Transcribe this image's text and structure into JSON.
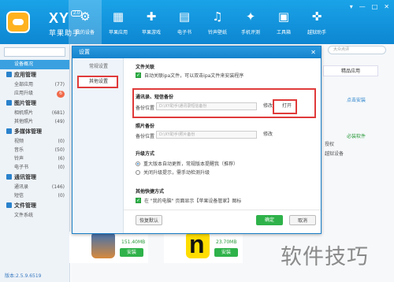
{
  "app": {
    "name": "XY",
    "version_badge": "2.0",
    "subtitle": "苹果助手"
  },
  "nav": [
    {
      "label": "我的设备",
      "icon": "device-icon",
      "glyph": "⚙"
    },
    {
      "label": "苹果应用",
      "icon": "apps-icon",
      "glyph": "▦"
    },
    {
      "label": "苹果游戏",
      "icon": "game-icon",
      "glyph": "✚"
    },
    {
      "label": "电子书",
      "icon": "ebook-icon",
      "glyph": "▤"
    },
    {
      "label": "铃声壁纸",
      "icon": "ringtone-icon",
      "glyph": "♫"
    },
    {
      "label": "手机评测",
      "icon": "review-icon",
      "glyph": "✦"
    },
    {
      "label": "工具箱",
      "icon": "toolbox-icon",
      "glyph": "▣"
    },
    {
      "label": "越狱助手",
      "icon": "jailbreak-icon",
      "glyph": "✜"
    }
  ],
  "window_controls": [
    "▾",
    "—",
    "□",
    "✕"
  ],
  "sidebar": {
    "device_overview": "设备概况",
    "groups": [
      {
        "title": "应用管理",
        "items": [
          {
            "label": "全部应用",
            "count": "(77)"
          },
          {
            "label": "应用升级",
            "count": "6",
            "badge": true
          }
        ]
      },
      {
        "title": "图片管理",
        "items": [
          {
            "label": "相机照片",
            "count": "(681)"
          },
          {
            "label": "其他照片",
            "count": "(49)"
          }
        ]
      },
      {
        "title": "多媒体管理",
        "items": [
          {
            "label": "视频",
            "count": "(0)"
          },
          {
            "label": "音乐",
            "count": "(50)"
          },
          {
            "label": "铃声",
            "count": "(6)"
          },
          {
            "label": "电子书",
            "count": "(0)"
          }
        ]
      },
      {
        "title": "通讯管理",
        "items": [
          {
            "label": "通讯录",
            "count": "(146)"
          },
          {
            "label": "短信",
            "count": "(0)"
          }
        ]
      },
      {
        "title": "文件管理",
        "items": [
          {
            "label": "文件系统",
            "count": ""
          }
        ]
      }
    ],
    "version": "版本:2.5.9.6519"
  },
  "right_panel": {
    "search_placeholder": "大众点评",
    "tab": "精品应用",
    "link1": "点击安装",
    "link2": "必装软件",
    "text1": "授权",
    "text2": "越狱设备"
  },
  "cards": [
    {
      "size": "151.40MB",
      "button": "安装"
    },
    {
      "size": "23.70MB",
      "button": "安装"
    }
  ],
  "watermark": "软件技巧",
  "dialog": {
    "title": "设置",
    "close": "✕",
    "side_items": [
      "常规设置",
      "其他设置"
    ],
    "file_assoc": {
      "title": "文件关联",
      "option": "自动关联ipa文件，可以双击ipa文件来安装程序"
    },
    "backup": {
      "title": "通讯录、短信备份",
      "label": "备份位置",
      "path": "D:\\XY助手\\通讯录短信备份",
      "modify": "修改",
      "open": "打开"
    },
    "photo_backup": {
      "title": "照片备份",
      "label": "备份位置",
      "path": "D:\\XY助手\\照片备份",
      "modify": "修改"
    },
    "upgrade": {
      "title": "升级方式",
      "opt1": "重大版本自动更新，常规版本提醒我（推荐）",
      "opt2": "关闭升级提示，需手动检测升级"
    },
    "shortcut": {
      "title": "其他快捷方式",
      "option": "在 \"我的电脑\" 页面显示【苹果设备管家】图标"
    },
    "buttons": {
      "restore": "恢复默认",
      "ok": "确定",
      "cancel": "取消"
    }
  }
}
